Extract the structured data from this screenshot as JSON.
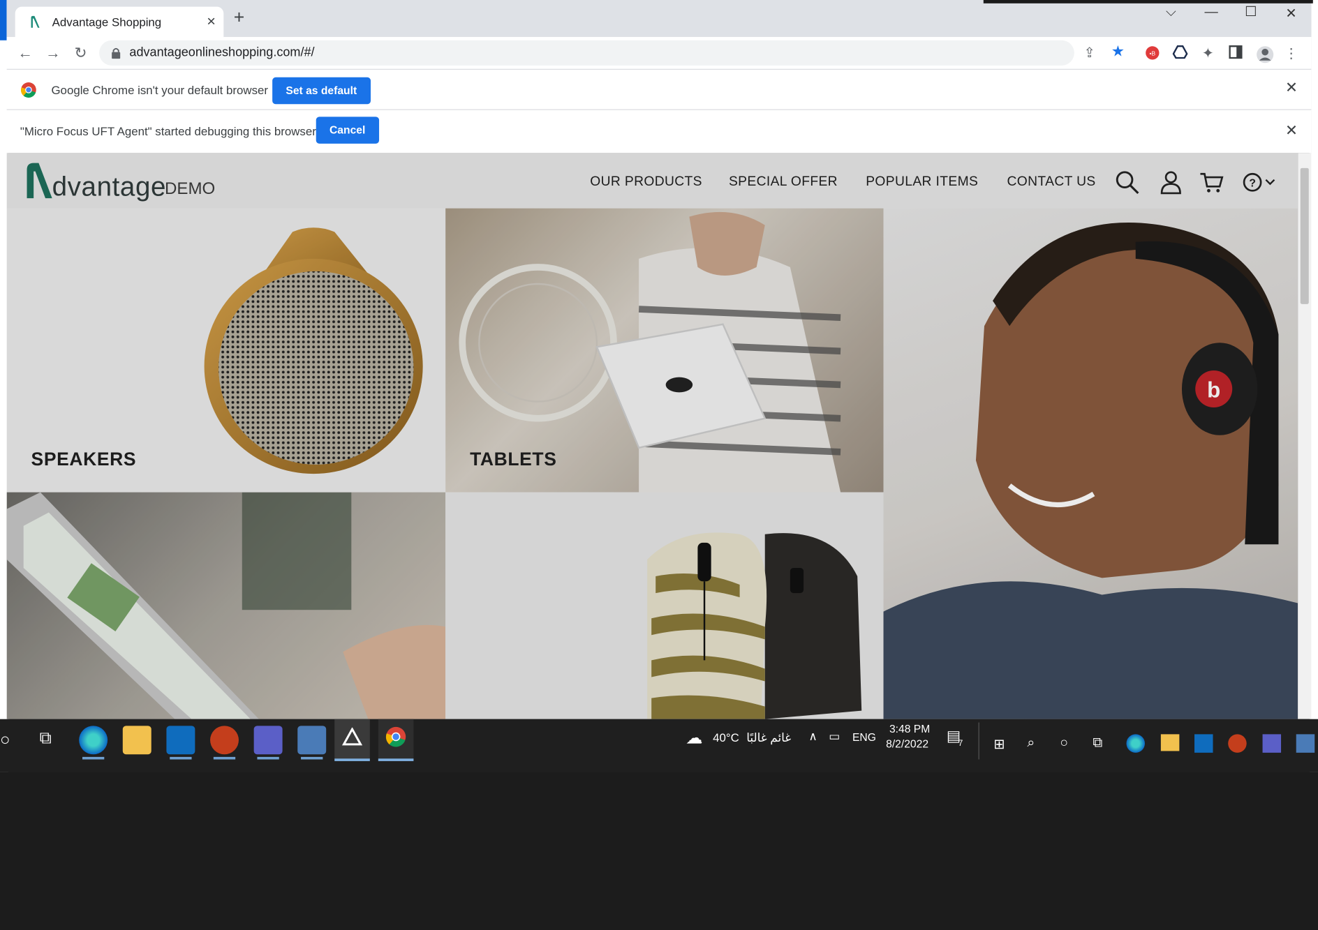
{
  "browser": {
    "tab_title": "Advantage Shopping",
    "tab_close": "×",
    "new_tab": "+",
    "url": "advantageonlineshopping.com/#/",
    "win_minimize": "—",
    "win_maximize": "☐",
    "win_close": "✕",
    "win_list": "⌵"
  },
  "infobars": [
    {
      "text": "Google Chrome isn't your default browser",
      "button": "Set as default",
      "close": "✕"
    },
    {
      "text": "\"Micro Focus UFT Agent\" started debugging this browser",
      "button": "Cancel",
      "close": "✕"
    }
  ],
  "site": {
    "logo": "dvantage",
    "logo_demo": "DEMO",
    "nav": [
      "OUR PRODUCTS",
      "SPECIAL OFFER",
      "POPULAR ITEMS",
      "CONTACT US"
    ],
    "tiles": {
      "speakers": "SPEAKERS",
      "tablets": "TABLETS"
    }
  },
  "taskbar": {
    "weather": "40°C",
    "weather_text": "غائم غالبًا",
    "lang": "ENG",
    "time": "3:48 PM",
    "date": "8/2/2022",
    "notifications": "7"
  },
  "colors": {
    "accent": "#1a73e8",
    "logo_green": "#1e6f5c",
    "taskbar": "#1f1f1f"
  }
}
